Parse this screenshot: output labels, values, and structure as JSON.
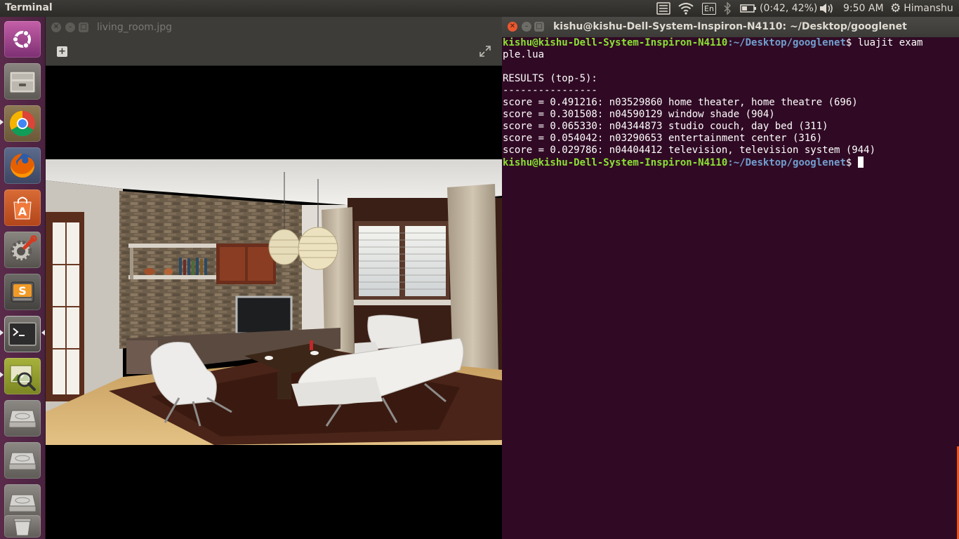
{
  "top_panel": {
    "app_title": "Terminal",
    "keyboard_layout": "En",
    "battery_text": "(0:42, 42%)",
    "clock": "9:50 AM",
    "user": "Himanshu"
  },
  "launcher": {
    "items": [
      {
        "name": "ubuntu-dash-icon"
      },
      {
        "name": "files-icon"
      },
      {
        "name": "chrome-icon"
      },
      {
        "name": "firefox-icon"
      },
      {
        "name": "software-center-icon"
      },
      {
        "name": "system-settings-icon"
      },
      {
        "name": "sublime-text-icon"
      },
      {
        "name": "terminal-icon"
      },
      {
        "name": "image-viewer-icon"
      },
      {
        "name": "drive-icon"
      },
      {
        "name": "drive-icon"
      },
      {
        "name": "drive-icon"
      },
      {
        "name": "trash-icon"
      }
    ],
    "accent_color": "#e95420"
  },
  "image_viewer": {
    "title": "living_room.jpg"
  },
  "terminal": {
    "title": "kishu@kishu-Dell-System-Inspiron-N4110: ~/Desktop/googlenet",
    "prompt_user": "kishu@kishu-Dell-System-Inspiron-N4110",
    "prompt_path": ":~/Desktop/googlenet",
    "prompt_symbol": "$ ",
    "command_line1": "luajit exam",
    "command_line2": "ple.lua",
    "results_header": "RESULTS (top-5):",
    "divider": "----------------",
    "results": [
      "score = 0.491216: n03529860 home theater, home theatre (696)",
      "score = 0.301508: n04590129 window shade (904)",
      "score = 0.065330: n04344873 studio couch, day bed (311)",
      "score = 0.054042: n03290653 entertainment center (316)",
      "score = 0.029786: n04404412 television, television system (944)"
    ],
    "bg_color": "#300a24",
    "user_color": "#8ae234",
    "path_color": "#729fcf"
  }
}
